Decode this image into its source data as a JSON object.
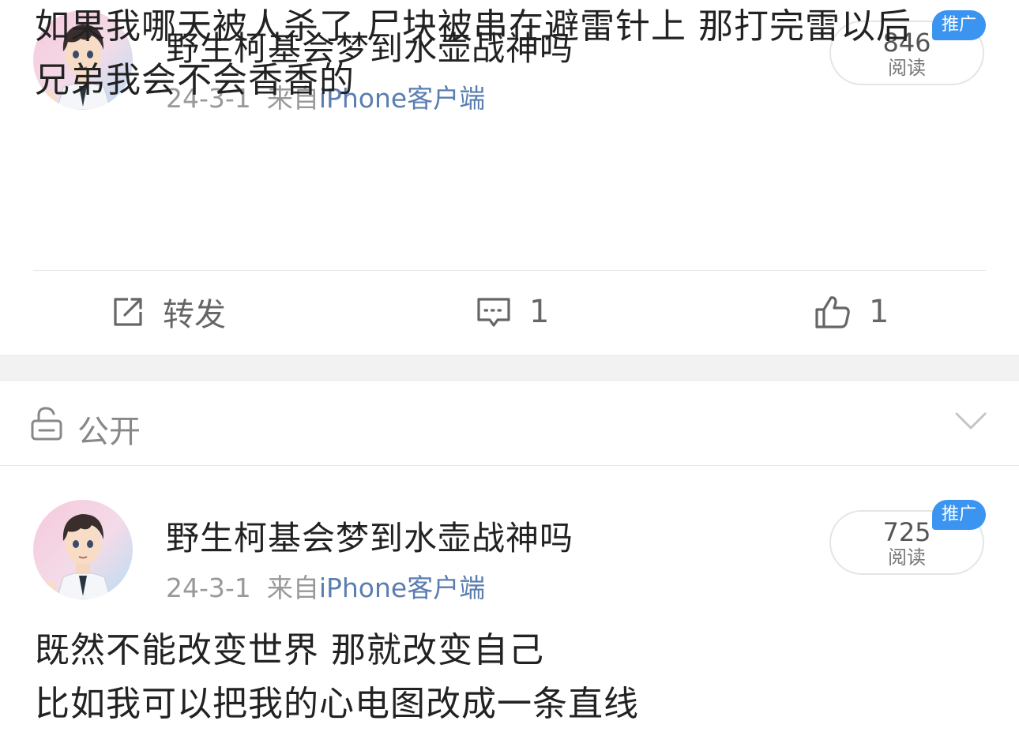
{
  "posts": [
    {
      "username": "野生柯基会梦到水壶战神吗",
      "date": "24-3-1",
      "source_prefix": "来自",
      "source_app": "iPhone客户端",
      "read_count": "846",
      "read_label": "阅读",
      "promo_badge": "推广",
      "content_lines": [
        "如果我哪天被人杀了 尸块被串在避雷针上 那打完雷以后",
        "兄弟我会不会香香的"
      ],
      "actions": {
        "repost_label": "转发",
        "comment_count": "1",
        "like_count": "1"
      }
    },
    {
      "username": "野生柯基会梦到水壶战神吗",
      "date": "24-3-1",
      "source_prefix": "来自",
      "source_app": "iPhone客户端",
      "read_count": "725",
      "read_label": "阅读",
      "promo_badge": "推广",
      "content_lines": [
        "既然不能改变世界 那就改变自己",
        "比如我可以把我的心电图改成一条直线"
      ]
    }
  ],
  "visibility": {
    "label": "公开",
    "icon": "lock-open-icon"
  },
  "colors": {
    "source_link": "#5a7eb0",
    "promo_badge": "#3b95f0",
    "separator_band": "#f2f2f2"
  },
  "icons": {
    "repost": "repost-icon",
    "comment": "comment-icon",
    "like": "thumbs-up-icon",
    "expand": "chevron-down-icon"
  }
}
